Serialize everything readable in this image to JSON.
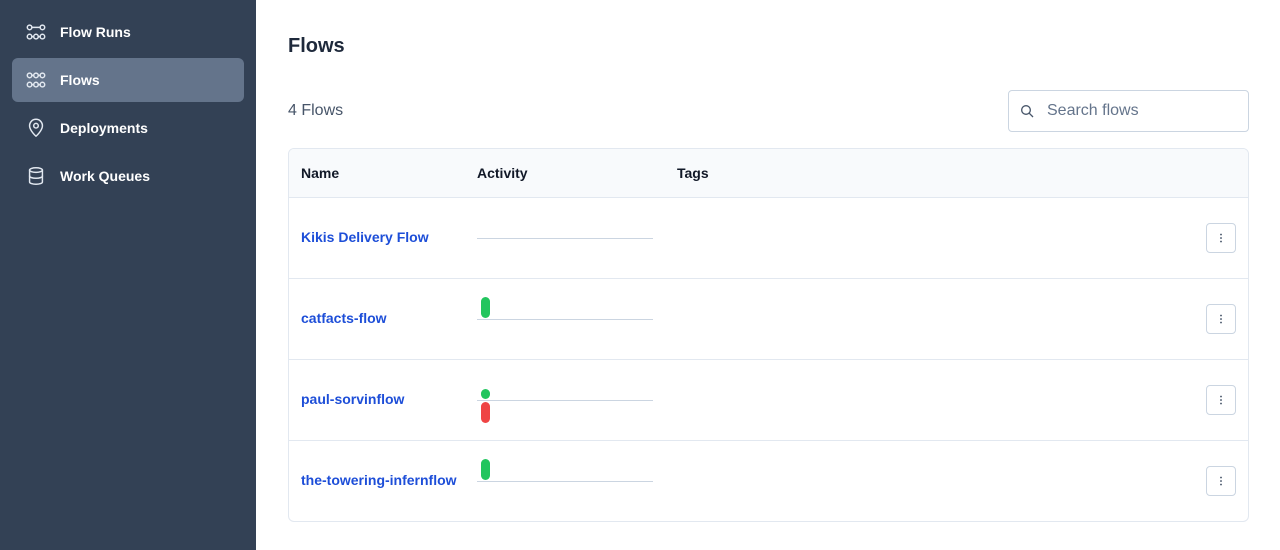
{
  "sidebar": {
    "items": [
      {
        "label": "Flow Runs",
        "icon": "flow-runs-icon",
        "active": false
      },
      {
        "label": "Flows",
        "icon": "flows-icon",
        "active": true
      },
      {
        "label": "Deployments",
        "icon": "map-pin-icon",
        "active": false
      },
      {
        "label": "Work Queues",
        "icon": "database-icon",
        "active": false
      }
    ]
  },
  "page": {
    "title": "Flows",
    "count": "4 Flows"
  },
  "search": {
    "placeholder": "Search flows",
    "value": ""
  },
  "table": {
    "columns": [
      "Name",
      "Activity",
      "Tags"
    ],
    "rows": [
      {
        "name": "Kikis Delivery Flow",
        "tags": [],
        "activity": []
      },
      {
        "name": "catfacts-flow",
        "tags": [],
        "activity": [
          {
            "state": "completed",
            "color": "#22c55e"
          }
        ]
      },
      {
        "name": "paul-sorvinflow",
        "tags": [],
        "activity": [
          {
            "state": "completed",
            "color": "#22c55e"
          },
          {
            "state": "failed",
            "color": "#ef4444"
          }
        ]
      },
      {
        "name": "the-towering-infernflow",
        "tags": [],
        "activity": [
          {
            "state": "completed",
            "color": "#22c55e"
          }
        ]
      }
    ]
  },
  "colors": {
    "sidebar_bg": "#334155",
    "active_nav": "#64748b",
    "link": "#1d4ed8",
    "success": "#22c55e",
    "failure": "#ef4444"
  }
}
